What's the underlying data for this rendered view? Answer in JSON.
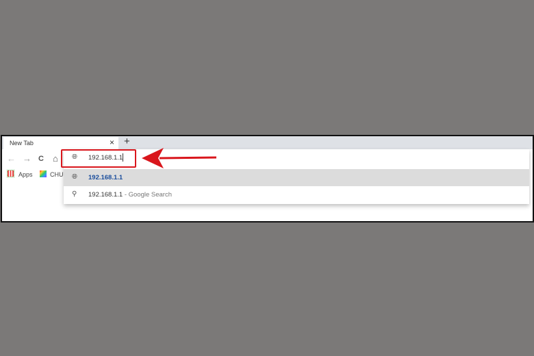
{
  "tab": {
    "title": "New Tab",
    "close": "×",
    "new_tab": "+"
  },
  "toolbar": {
    "back": "←",
    "forward": "→",
    "reload": "C",
    "home": "⌂"
  },
  "omnibox": {
    "value": "192.168.1.1",
    "icon": "globe-icon"
  },
  "bookmarks": [
    {
      "label": "Apps",
      "icon": "apps-grid-icon"
    },
    {
      "label": "CHUY",
      "icon": "colorful-folder-icon"
    }
  ],
  "suggestions": [
    {
      "icon": "globe-icon",
      "text": "192.168.1.1",
      "suffix": ""
    },
    {
      "icon": "search-icon",
      "text": "192.168.1.1",
      "suffix": " - Google Search"
    }
  ],
  "colors": {
    "highlight": "#d9161c",
    "link": "#1a4d9c",
    "background": "#7b7978"
  }
}
